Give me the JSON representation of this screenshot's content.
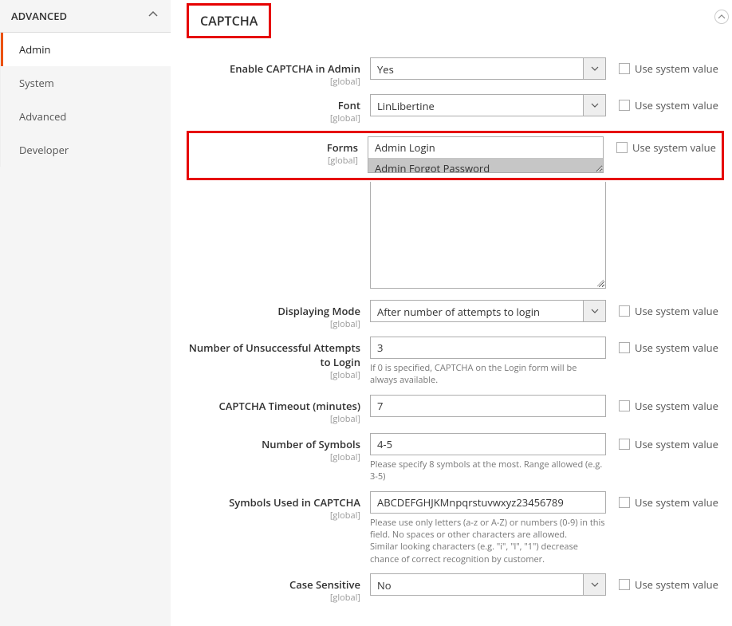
{
  "sidebar": {
    "header": "ADVANCED",
    "items": [
      {
        "label": "Admin",
        "active": true
      },
      {
        "label": "System",
        "active": false
      },
      {
        "label": "Advanced",
        "active": false
      },
      {
        "label": "Developer",
        "active": false
      }
    ]
  },
  "section": {
    "title": "CAPTCHA"
  },
  "scope_label": "[global]",
  "sys_value_label": "Use system value",
  "fields": {
    "enable": {
      "label": "Enable CAPTCHA in Admin",
      "value": "Yes"
    },
    "font": {
      "label": "Font",
      "value": "LinLibertine"
    },
    "forms": {
      "label": "Forms",
      "options": [
        "Admin Login",
        "Admin Forgot Password"
      ],
      "selected_index": 1
    },
    "mode": {
      "label": "Displaying Mode",
      "value": "After number of attempts to login"
    },
    "attempts": {
      "label": "Number of Unsuccessful Attempts to Login",
      "value": "3",
      "hint": "If 0 is specified, CAPTCHA on the Login form will be always available."
    },
    "timeout": {
      "label": "CAPTCHA Timeout (minutes)",
      "value": "7"
    },
    "symbols_count": {
      "label": "Number of Symbols",
      "value": "4-5",
      "hint": "Please specify 8 symbols at the most. Range allowed (e.g. 3-5)"
    },
    "symbols_used": {
      "label": "Symbols Used in CAPTCHA",
      "value": "ABCDEFGHJKMnpqrstuvwxyz23456789",
      "hint": "Please use only letters (a-z or A-Z) or numbers (0-9) in this field. No spaces or other characters are allowed.\nSimilar looking characters (e.g. \"i\", \"l\", \"1\") decrease chance of correct recognition by customer."
    },
    "case": {
      "label": "Case Sensitive",
      "value": "No"
    }
  }
}
